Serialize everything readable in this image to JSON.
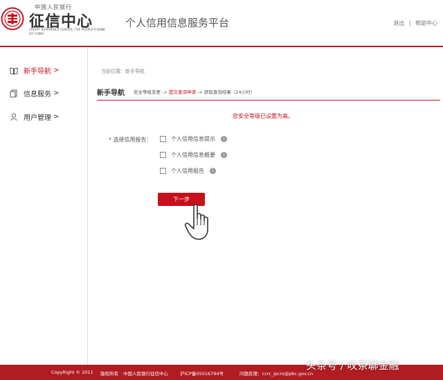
{
  "header": {
    "logo_top": "中国人民银行",
    "logo_main": "征信中心",
    "logo_en": "CREDIT REFERENCE CENTER, THE PEOPLE'S BANK OF CHINA",
    "site_title": "个人信用信息服务平台",
    "link_logout": "退出",
    "link_sep": "|",
    "link_help": "帮助中心"
  },
  "sidebar": {
    "items": [
      {
        "label": "新手导航",
        "arrow": ">",
        "icon": "book-icon"
      },
      {
        "label": "信息服务",
        "arrow": ">",
        "icon": "document-icon"
      },
      {
        "label": "用户管理",
        "arrow": ">",
        "icon": "user-icon"
      }
    ]
  },
  "main": {
    "breadcrumb": "当前位置：新手导航",
    "steps_title": "新手导航",
    "step1": "安全等级变更",
    "step_arrow": " -> ",
    "step2": "提交查询申请",
    "step3": "获取查询结果（24小时）",
    "notice": "您安全等级已设置为高。",
    "form_label": "* 选择信用报告：",
    "options": [
      {
        "label": "个人信用信息提示",
        "info": "i"
      },
      {
        "label": "个人信用信息概要",
        "info": "i"
      },
      {
        "label": "个人信用报告",
        "info": "i"
      }
    ],
    "next_button": "下一步"
  },
  "footer": {
    "copyright": "CopyRight © 2011",
    "rights": "版权所有",
    "owner": "中国人民银行征信中心",
    "icp": "沪ICP备05016794号",
    "feedback": "问题反馈：ccrc_ipcrs@pbc.gov.cn"
  },
  "watermark": "头条号 / 叹茶聊金融",
  "colors": {
    "brand_red": "#c8101a",
    "footer_red": "#b01c22"
  }
}
